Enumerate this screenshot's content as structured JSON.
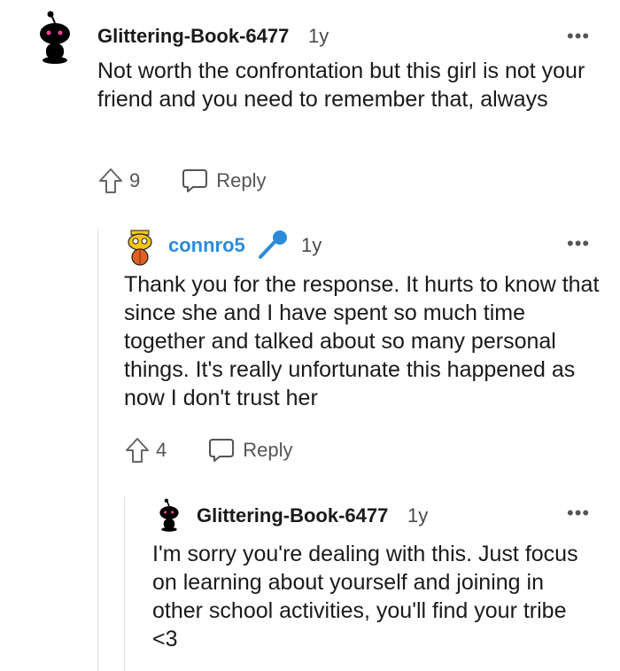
{
  "comments": [
    {
      "username": "Glittering-Book-6477",
      "age": "1y",
      "more": "•••",
      "body": "Not worth the confrontation but this girl is not your friend and you need to remember that, always",
      "votes": "9",
      "reply_label": "Reply"
    },
    {
      "username": "connro5",
      "age": "1y",
      "more": "•••",
      "body": "Thank you for the response. It hurts to know that since she and I have spent so much time together and talked about so many personal things. It's really unfortunate this happened as now I don't trust her",
      "votes": "4",
      "reply_label": "Reply"
    },
    {
      "username": "Glittering-Book-6477",
      "age": "1y",
      "more": "•••",
      "body": "I'm sorry you're dealing with this. Just focus on learning about yourself and joining in other school activities, you'll find your tribe <3"
    }
  ],
  "colors": {
    "op_username": "#2c8bd9",
    "mic_icon": "#2c8bd9",
    "thread_line": "#e0e0e0"
  }
}
